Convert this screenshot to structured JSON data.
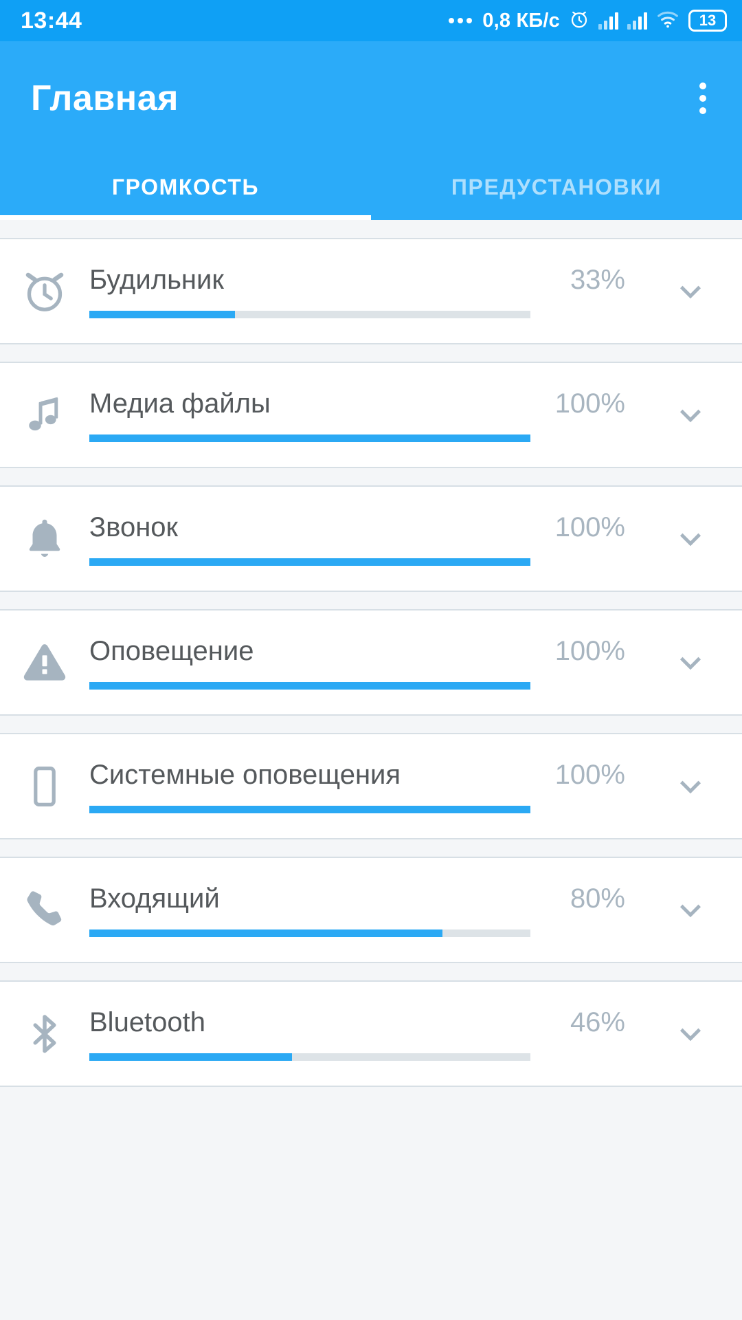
{
  "status_bar": {
    "time": "13:44",
    "net_speed": "0,8 КБ/с",
    "battery": "13",
    "icons": [
      "more-dots-icon",
      "alarm-icon",
      "signal-icon",
      "signal-icon",
      "wifi-icon",
      "battery-icon"
    ]
  },
  "app_bar": {
    "title": "Главная",
    "overflow_label": "overflow-menu-icon"
  },
  "tabs": [
    {
      "label": "ГРОМКОСТЬ",
      "active": true
    },
    {
      "label": "ПРЕДУСТАНОВКИ",
      "active": false
    }
  ],
  "colors": {
    "status_bar": "#0FA0F5",
    "app_bar": "#2BABF9",
    "accent": "#2BA9F4",
    "track": "#DDE3E7",
    "icon": "#A6B4C0",
    "label": "#55595C",
    "percent": "#A8B5C0",
    "page_bg": "#F4F6F8",
    "card_bg": "#FFFFFF"
  },
  "volume_rows": [
    {
      "icon": "alarm-clock-icon",
      "label": "Будильник",
      "percent": "33%",
      "value": 33
    },
    {
      "icon": "music-note-icon",
      "label": "Медиа файлы",
      "percent": "100%",
      "value": 100
    },
    {
      "icon": "bell-icon",
      "label": "Звонок",
      "percent": "100%",
      "value": 100
    },
    {
      "icon": "warning-triangle-icon",
      "label": "Оповещение",
      "percent": "100%",
      "value": 100
    },
    {
      "icon": "smartphone-icon",
      "label": "Системные оповещения",
      "percent": "100%",
      "value": 100
    },
    {
      "icon": "phone-handset-icon",
      "label": "Входящий",
      "percent": "80%",
      "value": 80
    },
    {
      "icon": "bluetooth-icon",
      "label": "Bluetooth",
      "percent": "46%",
      "value": 46
    }
  ]
}
